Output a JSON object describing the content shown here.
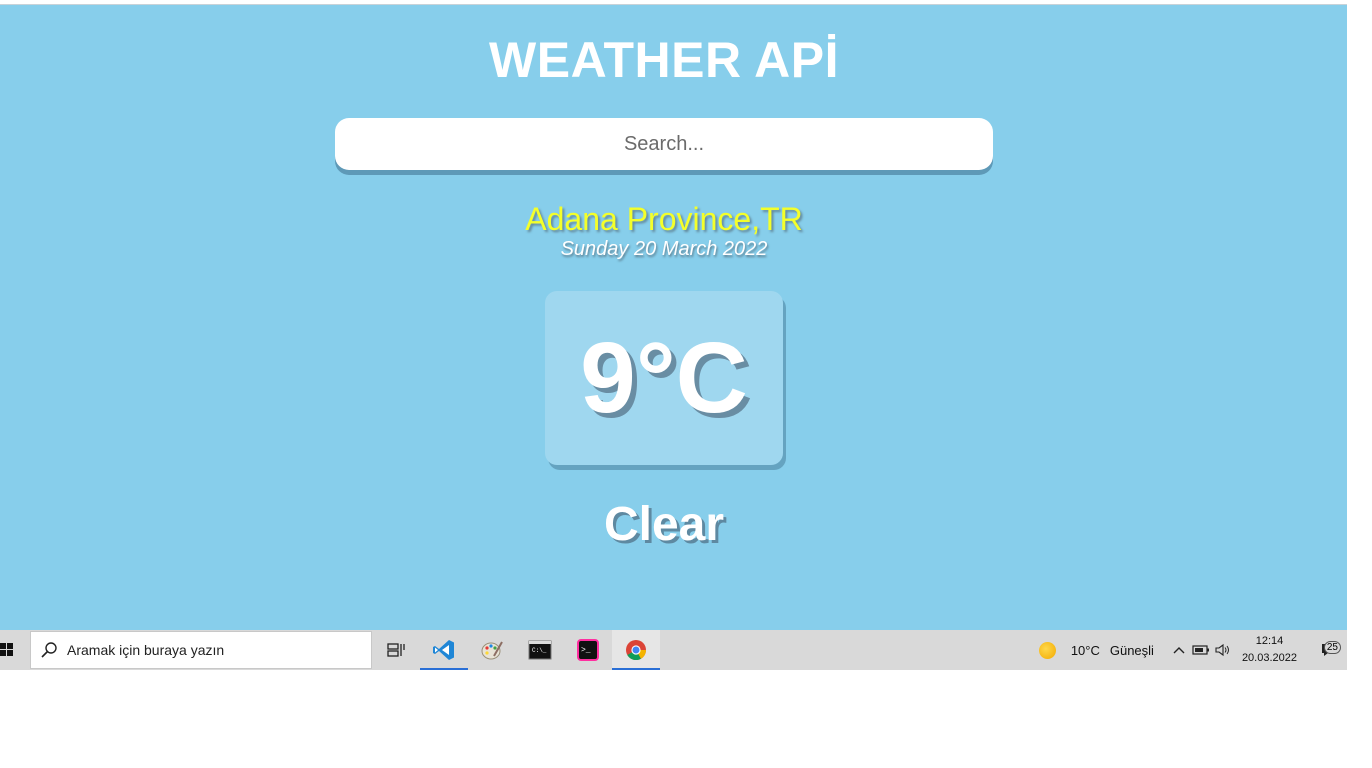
{
  "app": {
    "title": "WEATHER APİ",
    "search": {
      "placeholder": "Search...",
      "value": ""
    },
    "location": "Adana Province,TR",
    "date": "Sunday 20 March 2022",
    "temperature": "9°C",
    "condition": "Clear"
  },
  "taskbar": {
    "search_placeholder": "Aramak için buraya yazın",
    "apps": [
      "task-view",
      "vscode",
      "paint",
      "command-prompt",
      "terminal",
      "chrome"
    ],
    "weather": {
      "temp": "10°C",
      "label": "Güneşli"
    },
    "clock": {
      "time": "12:14",
      "date": "20.03.2022"
    },
    "notifications": "25"
  },
  "colors": {
    "background": "#87ceeb",
    "location": "#f4ff2a",
    "taskbar": "#d9d9d9"
  }
}
